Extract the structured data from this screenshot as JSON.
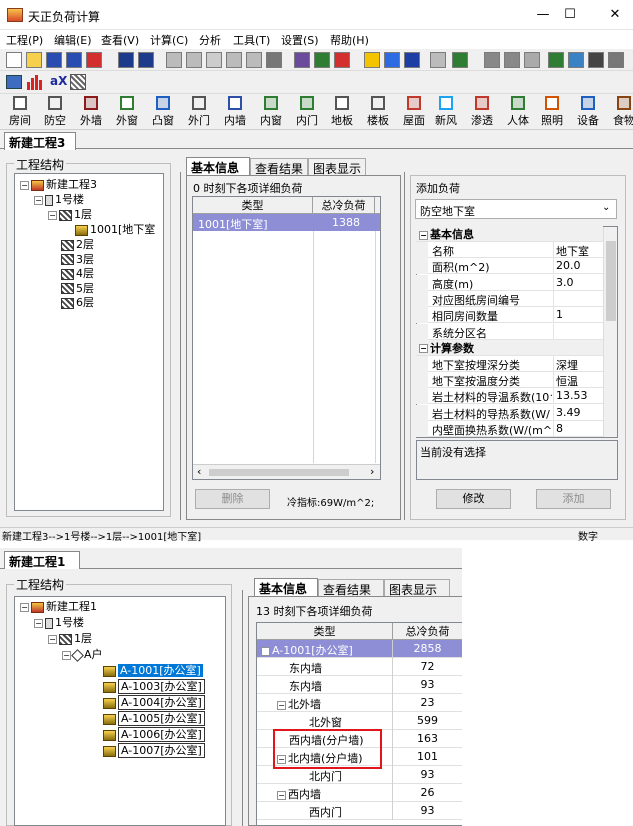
{
  "window": {
    "title": "天正负荷计算"
  },
  "menu": [
    "工程(P)",
    "编辑(E)",
    "查看(V)",
    "计算(C)",
    "分析",
    "工具(T)",
    "设置(S)",
    "帮助(H)"
  ],
  "big_toolbar": [
    "房间",
    "防空",
    "外墙",
    "外窗",
    "凸窗",
    "外门",
    "内墙",
    "内窗",
    "内门",
    "地板",
    "楼板",
    "屋面",
    "新风",
    "渗透",
    "人体",
    "照明",
    "设备",
    "食物"
  ],
  "toolbar_text": {
    "ax": "aX"
  },
  "top": {
    "doc_tab": "新建工程3",
    "tree_group": "工程结构",
    "tree": [
      "新建工程3",
      "1号楼",
      "1层",
      "1001[地下室",
      "2层",
      "3层",
      "4层",
      "5层",
      "6层"
    ],
    "tabs": [
      "基本信息",
      "查看结果",
      "图表显示"
    ],
    "grid_caption": "0 时刻下各项详细负荷",
    "grid_headers": [
      "类型",
      "总冷负荷"
    ],
    "grid_rows": [
      {
        "type": "1001[地下室]",
        "value": "1388"
      }
    ],
    "delete_btn": "删除",
    "cooling_index": "冷指标:69W/m^2;",
    "add_load_label": "添加负荷",
    "load_type": "防空地下室",
    "prop_cat1": "基本信息",
    "props1": [
      [
        "名称",
        "地下室"
      ],
      [
        "面积(m^2)",
        "20.0"
      ],
      [
        "高度(m)",
        "3.0"
      ],
      [
        "对应图纸房间编号",
        ""
      ],
      [
        "相同房间数量",
        "1"
      ],
      [
        "系统分区名",
        ""
      ]
    ],
    "prop_cat2": "计算参数",
    "props2": [
      [
        "地下室按埋深分类",
        "深埋"
      ],
      [
        "地下室按温度分类",
        "恒温"
      ],
      [
        "岩土材料的导温系数(10^",
        "13.53"
      ],
      [
        "岩土材料的导热系数(W/",
        "3.49"
      ],
      [
        "内壁面换热系数(W/(m^",
        "8"
      ]
    ],
    "no_select": "当前没有选择",
    "modify_btn": "修改",
    "add_btn": "添加",
    "status_path": "新建工程3-->1号楼-->1层-->1001[地下室]",
    "status_right": "数字"
  },
  "bottom": {
    "doc_tab": "新建工程1",
    "tree_group": "工程结构",
    "tree": [
      "新建工程1",
      "1号楼",
      "1层",
      "A户",
      "A-1001[办公室]",
      "A-1003[办公室]",
      "A-1004[办公室]",
      "A-1005[办公室]",
      "A-1006[办公室]",
      "A-1007[办公室]"
    ],
    "tabs": [
      "基本信息",
      "查看结果",
      "图表显示"
    ],
    "grid_caption": "13 时刻下各项详细负荷",
    "grid_headers": [
      "类型",
      "总冷负荷"
    ],
    "grid_rows": [
      {
        "type": "A-1001[办公室]",
        "value": "2858",
        "level": 0,
        "tgl": "−",
        "sel": true
      },
      {
        "type": "东内墙",
        "value": "72",
        "level": 1
      },
      {
        "type": "东内墙",
        "value": "93",
        "level": 1
      },
      {
        "type": "北外墙",
        "value": "23",
        "level": 1,
        "tgl": "−"
      },
      {
        "type": "北外窗",
        "value": "599",
        "level": 2
      },
      {
        "type": "西内墙(分户墙)",
        "value": "163",
        "level": 1
      },
      {
        "type": "北内墙(分户墙)",
        "value": "101",
        "level": 1,
        "tgl": "−"
      },
      {
        "type": "北内门",
        "value": "93",
        "level": 2
      },
      {
        "type": "西内墙",
        "value": "26",
        "level": 1,
        "tgl": "−"
      },
      {
        "type": "西内门",
        "value": "93",
        "level": 2
      }
    ]
  }
}
